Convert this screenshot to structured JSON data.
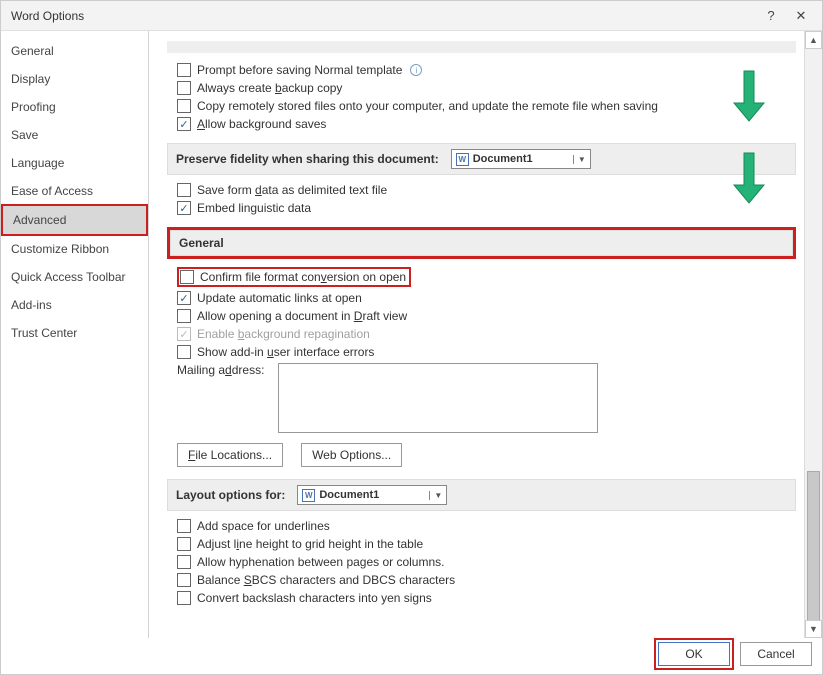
{
  "title": "Word Options",
  "sidebar": {
    "items": [
      {
        "label": "General"
      },
      {
        "label": "Display"
      },
      {
        "label": "Proofing"
      },
      {
        "label": "Save"
      },
      {
        "label": "Language"
      },
      {
        "label": "Ease of Access"
      },
      {
        "label": "Advanced"
      },
      {
        "label": "Customize Ribbon"
      },
      {
        "label": "Quick Access Toolbar"
      },
      {
        "label": "Add-ins"
      },
      {
        "label": "Trust Center"
      }
    ]
  },
  "save_opts": {
    "prompt": "Prompt before saving Normal template",
    "backup_pre": "Always create ",
    "backup_u": "b",
    "backup_post": "ackup copy",
    "remote": "Copy remotely stored files onto your computer, and update the remote file when saving",
    "bg_pre": "A",
    "bg_post": "llow background saves"
  },
  "fidelity": {
    "head": "Preserve fidelity when sharing this document:",
    "doc": "Document1",
    "form_pre": "Save form ",
    "form_u": "d",
    "form_post": "ata as delimited text file",
    "ling": "Embed linguistic data"
  },
  "general": {
    "head": "General",
    "confirm_pre": "Confirm file format con",
    "confirm_u": "v",
    "confirm_post": "ersion on open",
    "update": "Update automatic links at open",
    "draft_pre": "Allow opening a document in ",
    "draft_u": "D",
    "draft_post": "raft view",
    "bgrep_pre": "Enable ",
    "bgrep_u": "b",
    "bgrep_post": "ackground repagination",
    "addin_pre": "Show add-in ",
    "addin_u": "u",
    "addin_post": "ser interface errors",
    "mail_pre": "Mailing a",
    "mail_u": "d",
    "mail_post": "dress:",
    "file_loc": "File Locations...",
    "web_opt": "Web Options..."
  },
  "layout": {
    "head": "Layout options for:",
    "doc": "Document1",
    "under": "Add space for underlines",
    "adj_pre": "Adjust l",
    "adj_u": "i",
    "adj_post": "ne height to grid height in the table",
    "hyphen": "Allow hyphenation between pages or columns.",
    "sbcs_pre": "Balance ",
    "sbcs_u": "S",
    "sbcs_post": "BCS characters and DBCS characters",
    "yen": "Convert backslash characters into yen signs"
  },
  "footer": {
    "ok": "OK",
    "cancel": "Cancel"
  }
}
